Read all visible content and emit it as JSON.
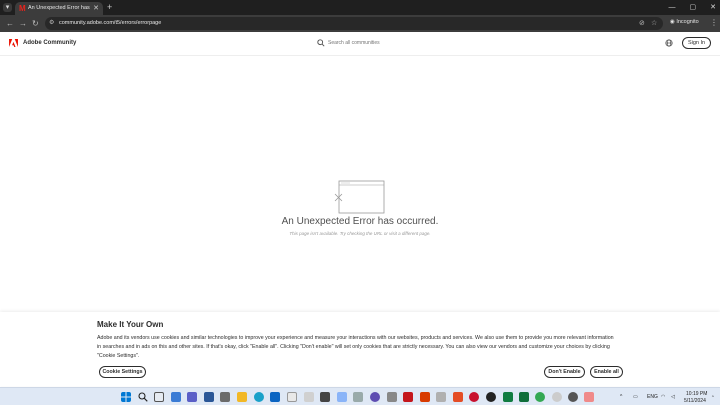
{
  "browser": {
    "tab_title": "An Unexpected Error has occu...",
    "url": "community.adobe.com/t5/errors/errorpage",
    "incognito_label": "Incognito"
  },
  "header": {
    "brand": "Adobe Community",
    "search_placeholder": "Search all communities",
    "sign_in": "Sign In"
  },
  "error": {
    "title": "An Unexpected Error has occurred.",
    "subtitle": "This page isn't available. Try checking the URL or visit a different page."
  },
  "cookie": {
    "title": "Make It Your Own",
    "text": "Adobe and its vendors use cookies and similar technologies to improve your experience and measure your interactions with our websites, products and services. We also use them to provide you more relevant information in searches and in ads on this and other sites. If that's okay, click \"Enable all\". Clicking \"Don't enable\" will set only cookies that are strictly necessary. You can also view our vendors and customize your choices by clicking \"Cookie Settings\".",
    "settings_label": "Cookie Settings",
    "dont_enable_label": "Don't Enable",
    "enable_all_label": "Enable all"
  },
  "taskbar": {
    "lang": "ENG",
    "time": "10:19 PM",
    "date": "5/11/2024"
  },
  "colors": {
    "adobe_red": "#eb1000",
    "chrome_dark": "#1f1f1f",
    "taskbar": "#dfe8f5"
  }
}
